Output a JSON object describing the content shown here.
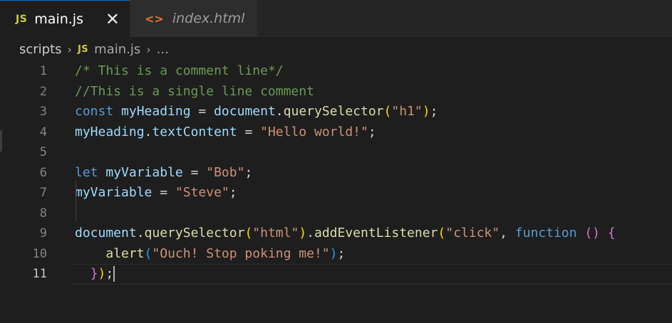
{
  "tabs": [
    {
      "badge": "JS",
      "label": "main.js",
      "close": "✕",
      "icon_name": "js-file-icon",
      "active": true
    },
    {
      "badge": "<>",
      "label": "index.html",
      "icon_name": "html-file-icon",
      "active": false
    }
  ],
  "breadcrumb": {
    "folder": "scripts",
    "separator": "›",
    "file_badge": "JS",
    "file": "main.js",
    "trailing": "..."
  },
  "colors": {
    "comment": "#6a9955",
    "keyword": "#569cd6",
    "variable": "#9cdcfe",
    "function": "#dcdcaa",
    "string": "#ce9178",
    "bracket_gold": "#ffd700",
    "bracket_pink": "#da70d6",
    "bracket_blue": "#179fff",
    "js_badge": "#cbcb41",
    "html_icon": "#e37933"
  },
  "editor": {
    "current_line": 11,
    "lines": [
      {
        "n": "1",
        "tokens": [
          {
            "t": "/* This is a comment line*/",
            "c": "comment"
          }
        ]
      },
      {
        "n": "2",
        "tokens": [
          {
            "t": "//This is a single line comment",
            "c": "comment"
          }
        ]
      },
      {
        "n": "3",
        "tokens": [
          {
            "t": "const",
            "c": "keyword"
          },
          {
            "t": " ",
            "c": "plain"
          },
          {
            "t": "myHeading",
            "c": "variable"
          },
          {
            "t": " = ",
            "c": "plain"
          },
          {
            "t": "document",
            "c": "variable"
          },
          {
            "t": ".",
            "c": "plain"
          },
          {
            "t": "querySelector",
            "c": "function"
          },
          {
            "t": "(",
            "c": "bracket_gold"
          },
          {
            "t": "\"h1\"",
            "c": "string"
          },
          {
            "t": ")",
            "c": "bracket_gold"
          },
          {
            "t": ";",
            "c": "plain"
          }
        ]
      },
      {
        "n": "4",
        "tokens": [
          {
            "t": "myHeading",
            "c": "variable"
          },
          {
            "t": ".",
            "c": "plain"
          },
          {
            "t": "textContent",
            "c": "variable"
          },
          {
            "t": " = ",
            "c": "plain"
          },
          {
            "t": "\"Hello world!\"",
            "c": "string"
          },
          {
            "t": ";",
            "c": "plain"
          }
        ]
      },
      {
        "n": "5",
        "tokens": []
      },
      {
        "n": "6",
        "tokens": [
          {
            "t": "let",
            "c": "keyword"
          },
          {
            "t": " ",
            "c": "plain"
          },
          {
            "t": "myVariable",
            "c": "variable"
          },
          {
            "t": " = ",
            "c": "plain"
          },
          {
            "t": "\"Bob\"",
            "c": "string"
          },
          {
            "t": ";",
            "c": "plain"
          }
        ]
      },
      {
        "n": "7",
        "tokens": [
          {
            "t": "myVariable",
            "c": "variable"
          },
          {
            "t": " = ",
            "c": "plain"
          },
          {
            "t": "\"Steve\"",
            "c": "string"
          },
          {
            "t": ";",
            "c": "plain"
          }
        ]
      },
      {
        "n": "8",
        "tokens": []
      },
      {
        "n": "9",
        "tokens": [
          {
            "t": "document",
            "c": "variable"
          },
          {
            "t": ".",
            "c": "plain"
          },
          {
            "t": "querySelector",
            "c": "function"
          },
          {
            "t": "(",
            "c": "bracket_gold"
          },
          {
            "t": "\"html\"",
            "c": "string"
          },
          {
            "t": ")",
            "c": "bracket_gold"
          },
          {
            "t": ".",
            "c": "plain"
          },
          {
            "t": "addEventListener",
            "c": "function"
          },
          {
            "t": "(",
            "c": "bracket_gold"
          },
          {
            "t": "\"click\"",
            "c": "string"
          },
          {
            "t": ", ",
            "c": "plain"
          },
          {
            "t": "function",
            "c": "keyword"
          },
          {
            "t": " ",
            "c": "plain"
          },
          {
            "t": "()",
            "c": "bracket_pink"
          },
          {
            "t": " ",
            "c": "plain"
          },
          {
            "t": "{",
            "c": "bracket_pink"
          }
        ]
      },
      {
        "n": "10",
        "tokens": [
          {
            "t": "    ",
            "c": "plain"
          },
          {
            "t": "alert",
            "c": "function"
          },
          {
            "t": "(",
            "c": "bracket_blue"
          },
          {
            "t": "\"Ouch! Stop poking me!\"",
            "c": "string"
          },
          {
            "t": ")",
            "c": "bracket_blue"
          },
          {
            "t": ";",
            "c": "plain"
          }
        ]
      },
      {
        "n": "11",
        "tokens": [
          {
            "t": "  ",
            "c": "plain"
          },
          {
            "t": "}",
            "c": "bracket_pink"
          },
          {
            "t": ")",
            "c": "bracket_gold"
          },
          {
            "t": ";",
            "c": "plain"
          }
        ],
        "cursor": true
      }
    ]
  }
}
